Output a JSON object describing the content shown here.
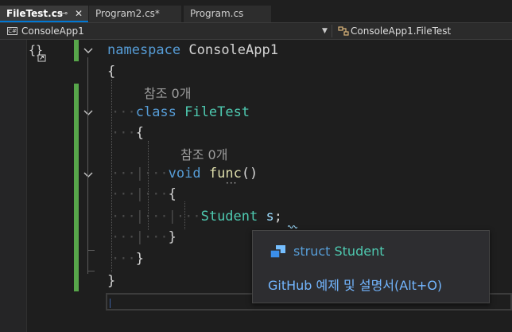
{
  "tabs": [
    {
      "label": "FileTest.cs",
      "active": true,
      "pin_icon": "pin-icon",
      "close_icon": "close-icon"
    },
    {
      "label": "Program2.cs*",
      "active": false
    },
    {
      "label": "Program.cs",
      "active": false
    }
  ],
  "navbar": {
    "project_icon": "csharp-project-icon",
    "project": "ConsoleApp1",
    "class_icon": "class-icon",
    "class": "ConsoleApp1.FileTest"
  },
  "editor": {
    "codelens": [
      "참조 0개",
      "참조 0개"
    ],
    "lines": {
      "namespace_kw": "namespace",
      "namespace_name": "ConsoleApp1",
      "open1": "{",
      "class_kw": "class",
      "class_name": "FileTest",
      "open2": "{",
      "void_kw": "void",
      "func_name": "func",
      "func_parens": "()",
      "open3": "{",
      "decl_type": "Student",
      "decl_var": "s",
      "decl_semicolon": ";",
      "close3": "}",
      "close2": "}",
      "close1": "}"
    }
  },
  "quickinfo": {
    "icon": "struct-icon",
    "keyword": "struct",
    "type_name": "Student",
    "link": "GitHub 예제 및 설명서(Alt+O)"
  },
  "colors": {
    "keyword": "#569cd6",
    "type": "#4ec9b0",
    "method": "#dcdcaa",
    "variable": "#9cdcfe",
    "change_bar": "#57a64a",
    "accent": "#0078d4",
    "link": "#73b6ff"
  }
}
